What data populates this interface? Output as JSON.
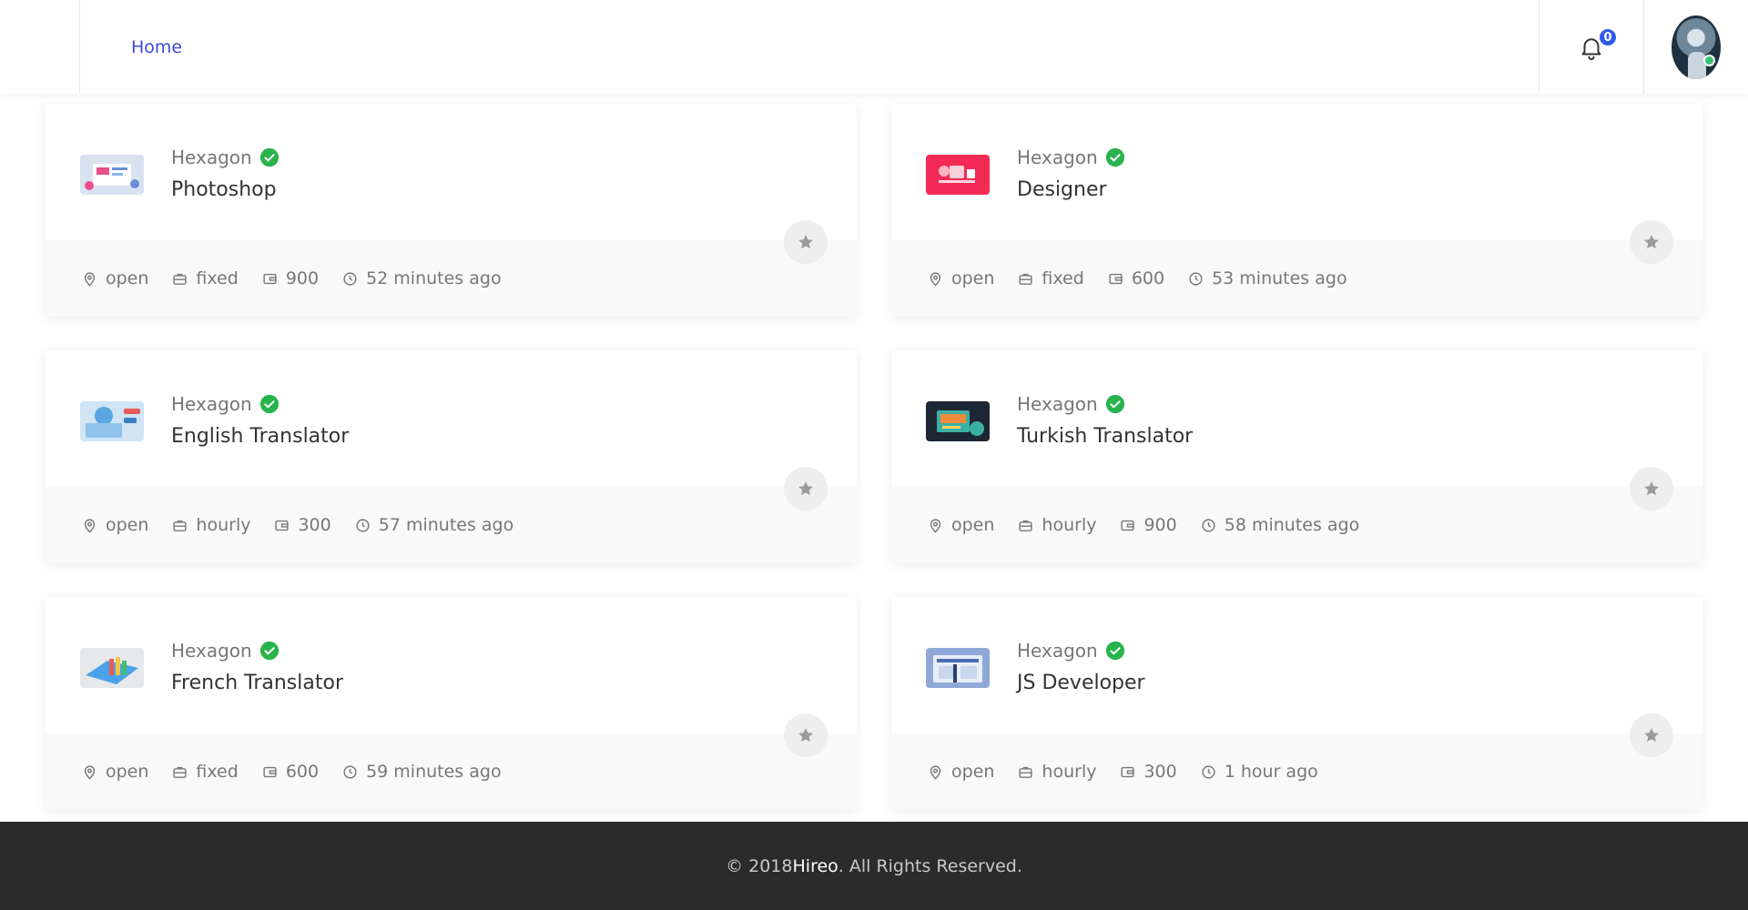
{
  "header": {
    "nav": {
      "home_label": "Home"
    },
    "notifications": {
      "count": "0",
      "icon": "bell-icon"
    },
    "user": {
      "avatar_icon": "avatar",
      "status_color": "#38c172"
    }
  },
  "colors": {
    "accent": "#3b4bd8",
    "badge": "#2f5be6",
    "verified": "#28b34b",
    "footer_bg": "#2b2b2b"
  },
  "jobs": [
    {
      "company": "Hexagon",
      "title": "Photoshop",
      "status": "open",
      "type": "fixed",
      "budget": "900",
      "posted": "52 minutes ago"
    },
    {
      "company": "Hexagon",
      "title": "Designer",
      "status": "open",
      "type": "fixed",
      "budget": "600",
      "posted": "53 minutes ago"
    },
    {
      "company": "Hexagon",
      "title": "English Translator",
      "status": "open",
      "type": "hourly",
      "budget": "300",
      "posted": "57 minutes ago"
    },
    {
      "company": "Hexagon",
      "title": "Turkish Translator",
      "status": "open",
      "type": "hourly",
      "budget": "900",
      "posted": "58 minutes ago"
    },
    {
      "company": "Hexagon",
      "title": "French Translator",
      "status": "open",
      "type": "fixed",
      "budget": "600",
      "posted": "59 minutes ago"
    },
    {
      "company": "Hexagon",
      "title": "JS Developer",
      "status": "open",
      "type": "hourly",
      "budget": "300",
      "posted": "1 hour ago"
    }
  ],
  "footer": {
    "prefix": "© 2018 ",
    "brand": "Hireo",
    "suffix": ". All Rights Reserved."
  }
}
